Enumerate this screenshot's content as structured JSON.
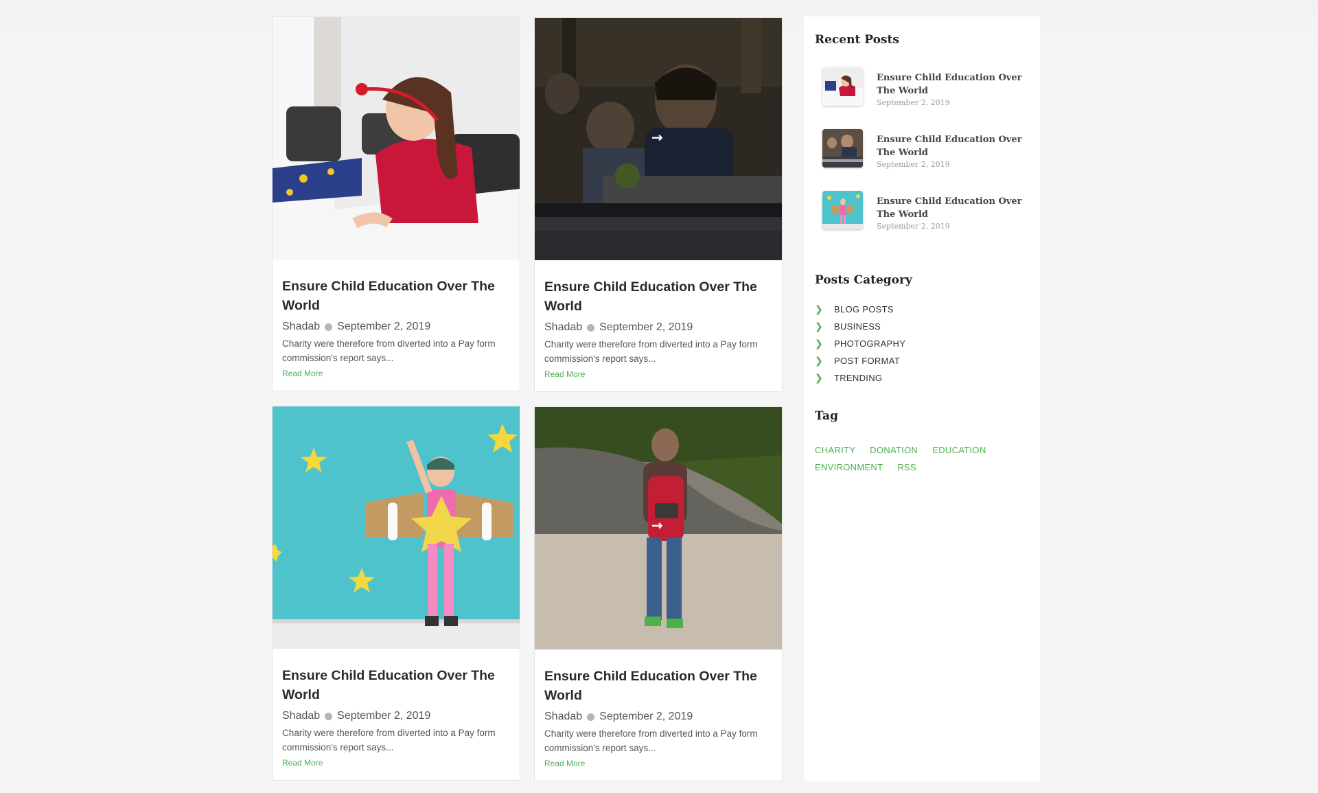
{
  "posts": [
    {
      "title": "Ensure Child Education Over The World",
      "author": "Shadab",
      "date": "September 2, 2019",
      "excerpt": "Charity were therefore from diverted into a Pay form commission's report says...",
      "read_more": "Read More"
    },
    {
      "title": "Ensure Child Education Over The World",
      "author": "Shadab",
      "date": "September 2, 2019",
      "excerpt": "Charity were therefore from diverted into a Pay form commission's report says...",
      "read_more": "Read More"
    },
    {
      "title": "Ensure Child Education Over The World",
      "author": "Shadab",
      "date": "September 2, 2019",
      "excerpt": "Charity were therefore from diverted into a Pay form commission's report says...",
      "read_more": "Read More"
    },
    {
      "title": "Ensure Child Education Over The World",
      "author": "Shadab",
      "date": "September 2, 2019",
      "excerpt": "Charity were therefore from diverted into a Pay form commission's report says...",
      "read_more": "Read More"
    }
  ],
  "sidebar": {
    "recent_title": "Recent Posts",
    "recent": [
      {
        "title": "Ensure Child Education Over The World",
        "date": "September 2, 2019"
      },
      {
        "title": "Ensure Child Education Over The World",
        "date": "September 2, 2019"
      },
      {
        "title": "Ensure Child Education Over The World",
        "date": "September 2, 2019"
      }
    ],
    "category_title": "Posts Category",
    "categories": [
      "BLOG POSTS",
      "BUSINESS",
      "PHOTOGRAPHY",
      "POST FORMAT",
      "TRENDING"
    ],
    "tag_title": "Tag",
    "tags": [
      "CHARITY",
      "DONATION",
      "EDUCATION",
      "ENVIRONMENT",
      "RSS"
    ]
  },
  "colors": {
    "accent": "#4caf50",
    "page_bg": "#f5f5f5",
    "title_text": "#2a2a2a"
  },
  "icons": {
    "hover_arrow": "arrow-right-icon",
    "category_bullet": "chevron-right-icon",
    "meta_separator": "dot-icon"
  }
}
